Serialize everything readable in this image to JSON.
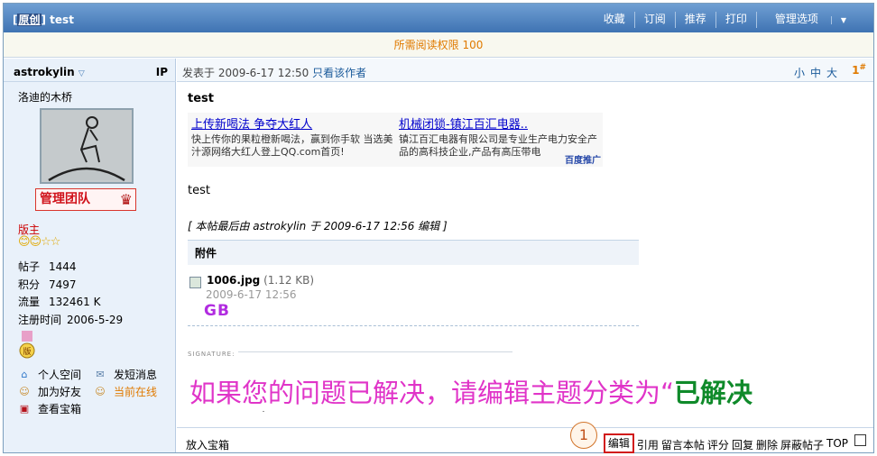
{
  "header": {
    "title_bracket_open": "[",
    "title_tag": "原创",
    "title_bracket_close": "]",
    "title_text": "test",
    "menu": [
      "收藏",
      "订阅",
      "推荐",
      "打印",
      "管理选项"
    ]
  },
  "permission": "所需阅读权限 100",
  "sidebar": {
    "username": "astrokylin",
    "ip": "IP",
    "custom_title": "洛迪的木桥",
    "group_badge": "管理团队",
    "role": "版主",
    "stars": "😊😊☆☆",
    "stats": [
      {
        "label": "帖子",
        "value": "1444"
      },
      {
        "label": "积分",
        "value": "7497"
      },
      {
        "label": "流量",
        "value": "132461 K"
      },
      {
        "label": "注册时间",
        "value": "2006-5-29"
      }
    ],
    "medal_label": "版",
    "links": {
      "space": "个人空间",
      "message": "发短消息",
      "add_friend": "加为好友",
      "online": "当前在线",
      "treasure": "查看宝箱"
    }
  },
  "post": {
    "posted_at": "发表于 2009-6-17 12:50",
    "only_author": "只看该作者",
    "font_sizes": [
      "小",
      "中",
      "大"
    ],
    "floor": "1",
    "floor_sup": "#",
    "title": "test",
    "ads": [
      {
        "headline": "上传新喝法 争夺大红人",
        "desc": "快上传你的果粒橙新喝法，赢到你手软 当选美汁源网络大红人登上QQ.com首页!"
      },
      {
        "headline": "机械闭锁-镇江百汇电器..",
        "desc": "镇江百汇电器有限公司是专业生产电力安全产品的高科技企业,产品有高压带电"
      }
    ],
    "ad_brand": "百度推广",
    "body": "test",
    "edited_note": "[ 本帖最后由 astrokylin 于 2009-6-17 12:56 编辑 ]",
    "attachment": {
      "header": "附件",
      "filename": "1006.jpg",
      "size": "(1.12 KB)",
      "date": "2009-6-17 12:56",
      "preview_text": "GB"
    },
    "signature_label": "SIGNATURE:",
    "big_message": "如果您的问题已解决，请编辑主题分类为",
    "big_message_quote": "“",
    "big_message_highlight": "已解决"
  },
  "footer": {
    "left": "放入宝箱",
    "edit": "编辑",
    "actions": [
      "引用",
      "留言本帖",
      "评分",
      "回复",
      "删除",
      "屏蔽帖子",
      "TOP"
    ],
    "marker": "1"
  },
  "colors": {
    "header_bg": "#3f73b3",
    "permission_text": "#e07a00",
    "message_pink": "#e034c8",
    "message_green": "#0f8a2a",
    "highlight_red": "#d11818"
  }
}
